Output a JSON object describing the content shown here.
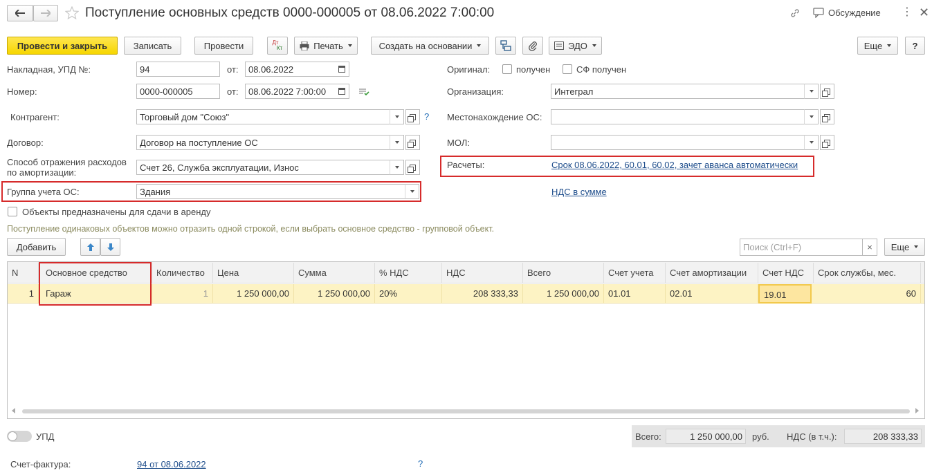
{
  "title": "Поступление основных средств 0000-000005 от 08.06.2022 7:00:00",
  "header_right": {
    "discuss_label": "Обсуждение"
  },
  "toolbar": {
    "post_close": "Провести и закрыть",
    "save": "Записать",
    "post": "Провести",
    "dtkt_top": "Дт",
    "dtkt_bottom": "Кт",
    "print": "Печать",
    "create_based": "Создать на основании",
    "edo": "ЭДО",
    "more": "Еще",
    "help": "?"
  },
  "form": {
    "invoice_label": "Накладная, УПД №:",
    "invoice_no": "94",
    "from_label": "от:",
    "invoice_date": "08.06.2022",
    "number_label": "Номер:",
    "number": "0000-000005",
    "number_date": "08.06.2022  7:00:00",
    "counterparty_label": "Контрагент:",
    "counterparty": "Торговый дом \"Союз\"",
    "contract_label": "Договор:",
    "contract": "Договор на поступление ОС",
    "expense_label_1": "Способ отражения расходов",
    "expense_label_2": "по амортизации:",
    "expense": "Счет 26, Служба эксплуатации, Износ",
    "group_label": "Группа учета ОС:",
    "group": "Здания",
    "rent_label": "Объекты предназначены для сдачи в аренду",
    "original_label": "Оригинал:",
    "received_label": "получен",
    "sf_received_label": "СФ получен",
    "org_label": "Организация:",
    "org": "Интеграл",
    "location_label": "Местонахождение ОС:",
    "location": "",
    "mol_label": "МОЛ:",
    "mol": "",
    "settlements_label": "Расчеты:",
    "settlements_link": "Срок 08.06.2022, 60.01, 60.02, зачет аванса автоматически",
    "vat_link": "НДС в сумме",
    "hint": "Поступление одинаковых объектов можно отразить одной строкой, если выбрать основное средство - групповой объект.",
    "question": "?"
  },
  "table_toolbar": {
    "add": "Добавить",
    "search_placeholder": "Поиск (Ctrl+F)",
    "clear": "×",
    "more": "Еще"
  },
  "table": {
    "headers": [
      "N",
      "Основное средство",
      "Количество",
      "Цена",
      "Сумма",
      "% НДС",
      "НДС",
      "Всего",
      "Счет учета",
      "Счет амортизации",
      "Счет НДС",
      "Срок службы, мес."
    ],
    "rows": [
      [
        "1",
        "Гараж",
        "1",
        "1 250 000,00",
        "1 250 000,00",
        "20%",
        "208 333,33",
        "1 250 000,00",
        "01.01",
        "02.01",
        "19.01",
        "60"
      ]
    ]
  },
  "footer": {
    "upd_label": "УПД",
    "total_label": "Всего:",
    "total": "1 250 000,00",
    "currency": "руб.",
    "vat_label": "НДС (в т.ч.):",
    "vat": "208 333,33",
    "invoice_label": "Счет-фактура:",
    "invoice_link": "94 от 08.06.2022",
    "question": "?"
  },
  "colors": {
    "accent": "#f6d600",
    "highlight_row": "#fdf3c4",
    "red_box": "#d62b2b",
    "link": "#1f4e8c"
  }
}
